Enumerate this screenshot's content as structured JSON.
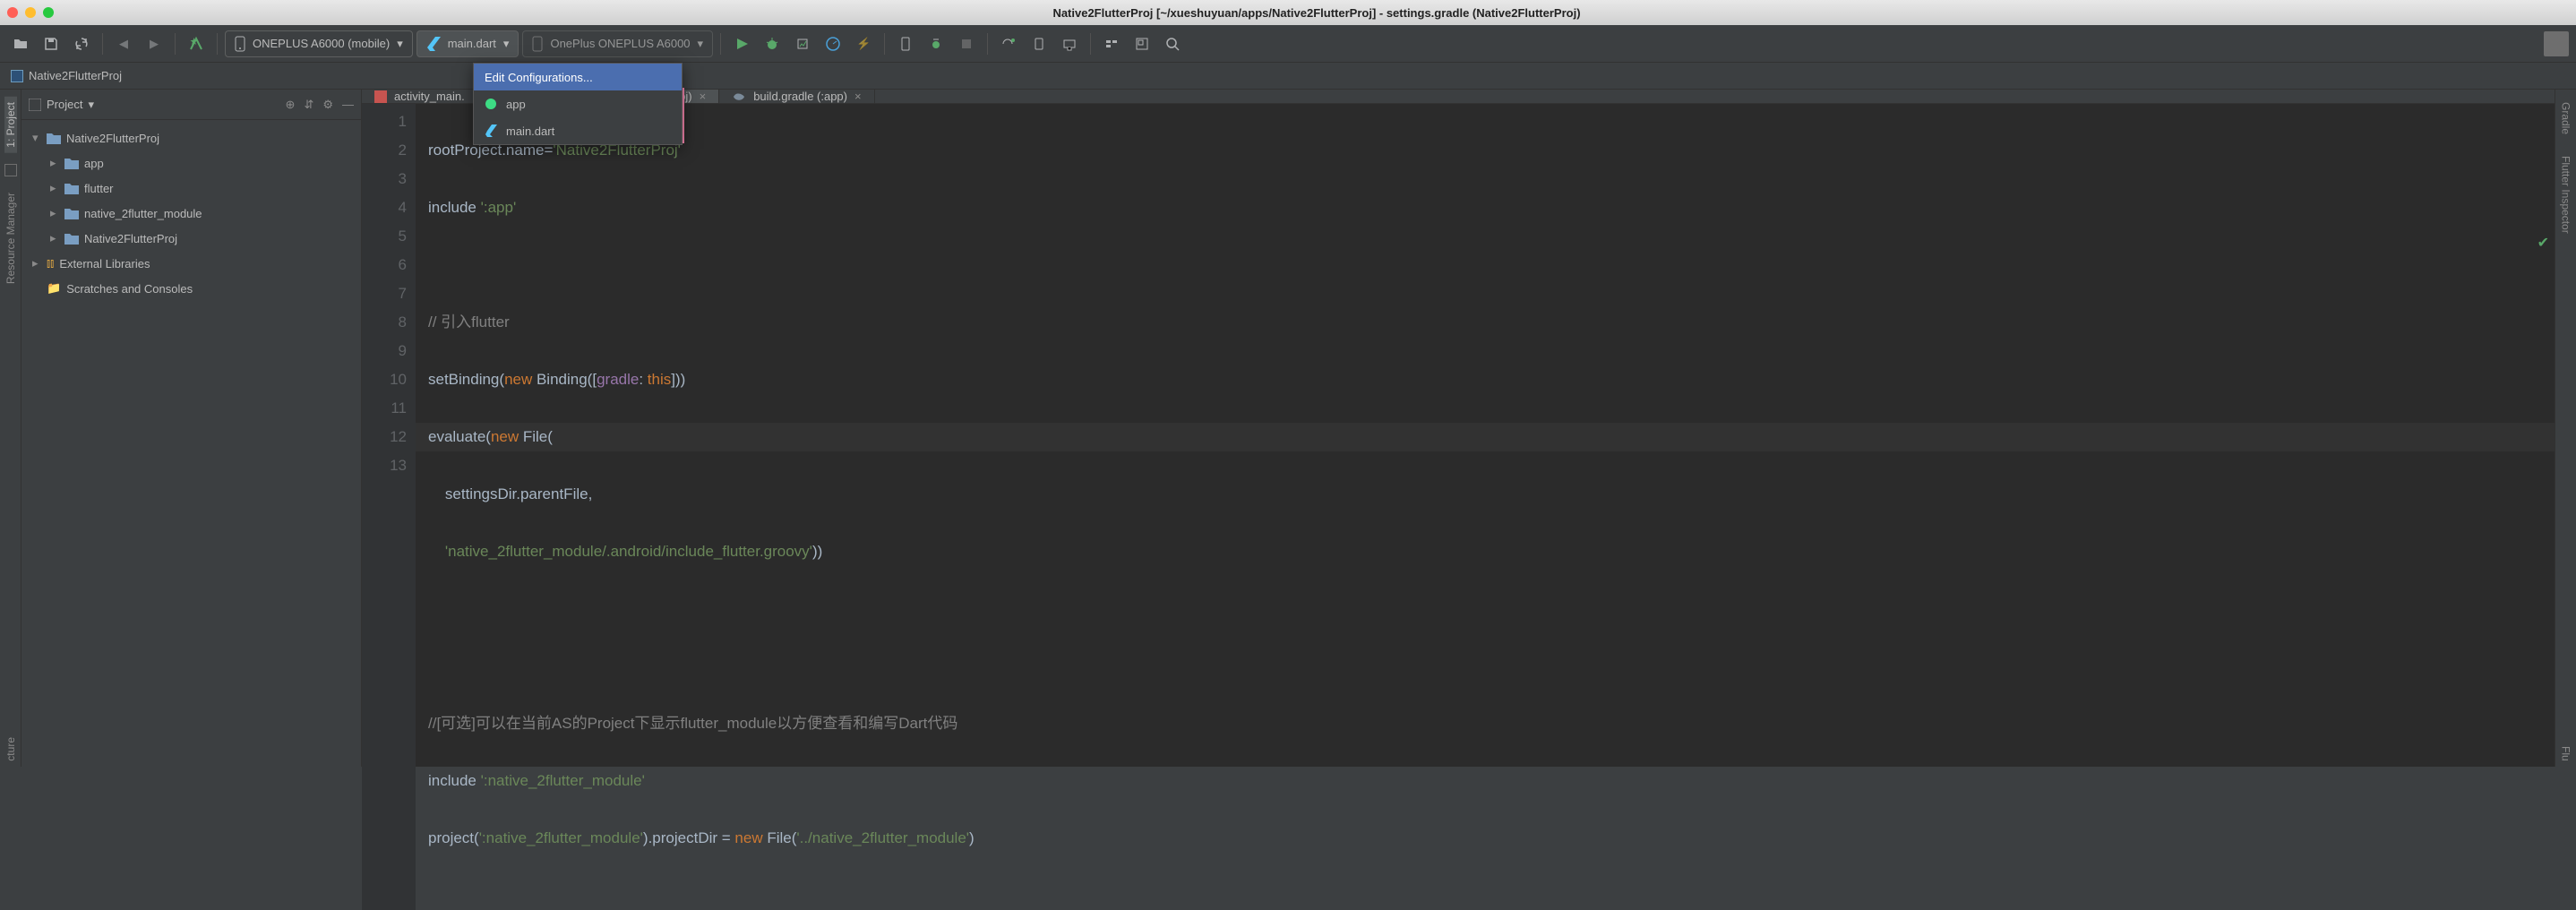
{
  "title": "Native2FlutterProj [~/xueshuyuan/apps/Native2FlutterProj] - settings.gradle (Native2FlutterProj)",
  "breadcrumb": {
    "project": "Native2FlutterProj"
  },
  "toolbar": {
    "device": "ONEPLUS A6000 (mobile)",
    "config": "main.dart",
    "target": "OnePlus ONEPLUS A6000"
  },
  "run_dropdown": {
    "item0": "Edit Configurations...",
    "item1": "app",
    "item2": "main.dart"
  },
  "left_tabs": {
    "t0": "1: Project",
    "t1": "Resource Manager",
    "t2": "cture"
  },
  "right_tabs": {
    "t0": "Gradle",
    "t1": "Flutter Inspector",
    "t2": "Flu"
  },
  "project_panel": {
    "title": "Project",
    "tree": {
      "n0": "Native2FlutterProj",
      "n1": "app",
      "n2": "flutter",
      "n3": "native_2flutter_module",
      "n4": "Native2FlutterProj",
      "n5": "External Libraries",
      "n6": "Scratches and Consoles"
    }
  },
  "tabs": {
    "t0": "activity_main.",
    "t1": "settings.gradle (Native2FlutterProj)",
    "t2": "build.gradle (:app)"
  },
  "code": {
    "l1a": "rootProject.name=",
    "l1b": "'Native2FlutterProj'",
    "l2a": "include ",
    "l2b": "':app'",
    "l4": "// 引入flutter",
    "l5a": "setBinding(",
    "l5b": "new",
    "l5c": " Binding([",
    "l5d": "gradle",
    "l5e": ": ",
    "l5f": "this",
    "l5g": "]))",
    "l6a": "evaluate(",
    "l6b": "new",
    "l6c": " File(",
    "l7a": "    settingsDir.parentFile,",
    "l8a": "    ",
    "l8b": "'native_2flutter_module/.android/include_flutter.groovy'",
    "l8c": "))",
    "l11": "//[可选]可以在当前AS的Project下显示flutter_module以方便查看和编写Dart代码",
    "l12a": "include ",
    "l12b": "':native_2flutter_module'",
    "l13a": "project(",
    "l13b": "':native_2flutter_module'",
    "l13c": ").projectDir = ",
    "l13d": "new",
    "l13e": " File(",
    "l13f": "'../native_2flutter_module'",
    "l13g": ")"
  },
  "gutter": {
    "l1": "1",
    "l2": "2",
    "l3": "3",
    "l4": "4",
    "l5": "5",
    "l6": "6",
    "l7": "7",
    "l8": "8",
    "l9": "9",
    "l10": "10",
    "l11": "11",
    "l12": "12",
    "l13": "13"
  }
}
